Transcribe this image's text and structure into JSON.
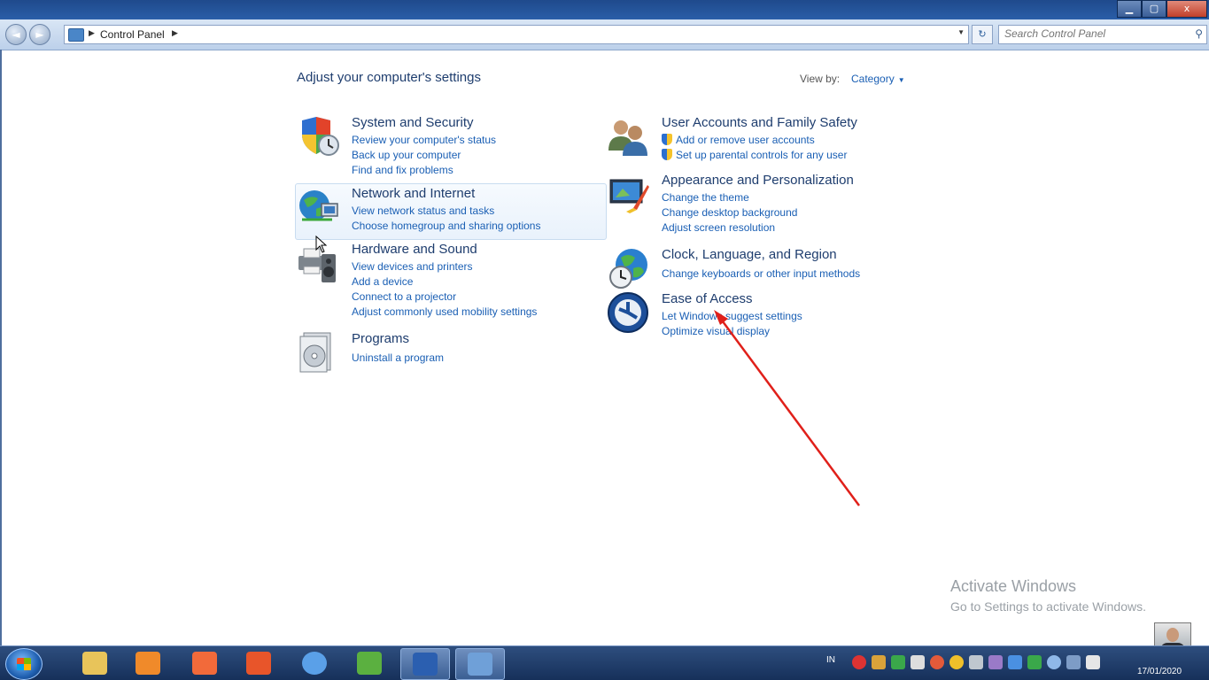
{
  "window": {
    "min_glyph": "▁",
    "max_glyph": "▢",
    "close_glyph": "x"
  },
  "nav": {
    "back_glyph": "◄",
    "forward_glyph": "►",
    "breadcrumb": "Control Panel",
    "refresh_glyph": "↻",
    "search_placeholder": "Search Control Panel",
    "search_icon": "⚲"
  },
  "main": {
    "heading": "Adjust your computer's settings",
    "view_by_label": "View by:",
    "view_by_value": "Category"
  },
  "categories_left": [
    {
      "icon": "shield-clock-icon",
      "title": "System and Security",
      "links": [
        "Review your computer's status",
        "Back up your computer",
        "Find and fix problems"
      ]
    },
    {
      "icon": "globe-network-icon",
      "title": "Network and Internet",
      "links": [
        "View network status and tasks",
        "Choose homegroup and sharing options"
      ]
    },
    {
      "icon": "printer-speaker-icon",
      "title": "Hardware and Sound",
      "links": [
        "View devices and printers",
        "Add a device",
        "Connect to a projector",
        "Adjust commonly used mobility settings"
      ]
    },
    {
      "icon": "programs-disc-icon",
      "title": "Programs",
      "links": [
        "Uninstall a program"
      ]
    }
  ],
  "categories_right": [
    {
      "icon": "users-icon",
      "title": "User Accounts and Family Safety",
      "links": [
        "Add or remove user accounts",
        "Set up parental controls for any user"
      ]
    },
    {
      "icon": "monitor-paint-icon",
      "title": "Appearance and Personalization",
      "links": [
        "Change the theme",
        "Change desktop background",
        "Adjust screen resolution"
      ]
    },
    {
      "icon": "globe-clock-icon",
      "title": "Clock, Language, and Region",
      "links": [
        "Change keyboards or other input methods"
      ]
    },
    {
      "icon": "ease-of-access-icon",
      "title": "Ease of Access",
      "links": [
        "Let Windows suggest settings",
        "Optimize visual display"
      ]
    }
  ],
  "watermark": {
    "line1": "Activate Windows",
    "line2": "Go to Settings to activate Windows."
  },
  "taskbar": {
    "apps": [
      {
        "name": "file-explorer-icon",
        "color": "#e8c45a"
      },
      {
        "name": "media-player-icon",
        "color": "#f08a2a"
      },
      {
        "name": "camera-app-icon",
        "color": "#f26a3a"
      },
      {
        "name": "slides-app-icon",
        "color": "#e8552a"
      },
      {
        "name": "browser-icon",
        "color": "#5aa0e8"
      },
      {
        "name": "sheets-app-icon",
        "color": "#5bb040"
      },
      {
        "name": "word-icon",
        "color": "#2b5fb0"
      },
      {
        "name": "control-panel-icon",
        "color": "#6fa0d8"
      }
    ],
    "language": "IN",
    "date": "17/01/2020"
  },
  "accent_color": "#1a5fb4",
  "annotation_color": "#e0201a"
}
